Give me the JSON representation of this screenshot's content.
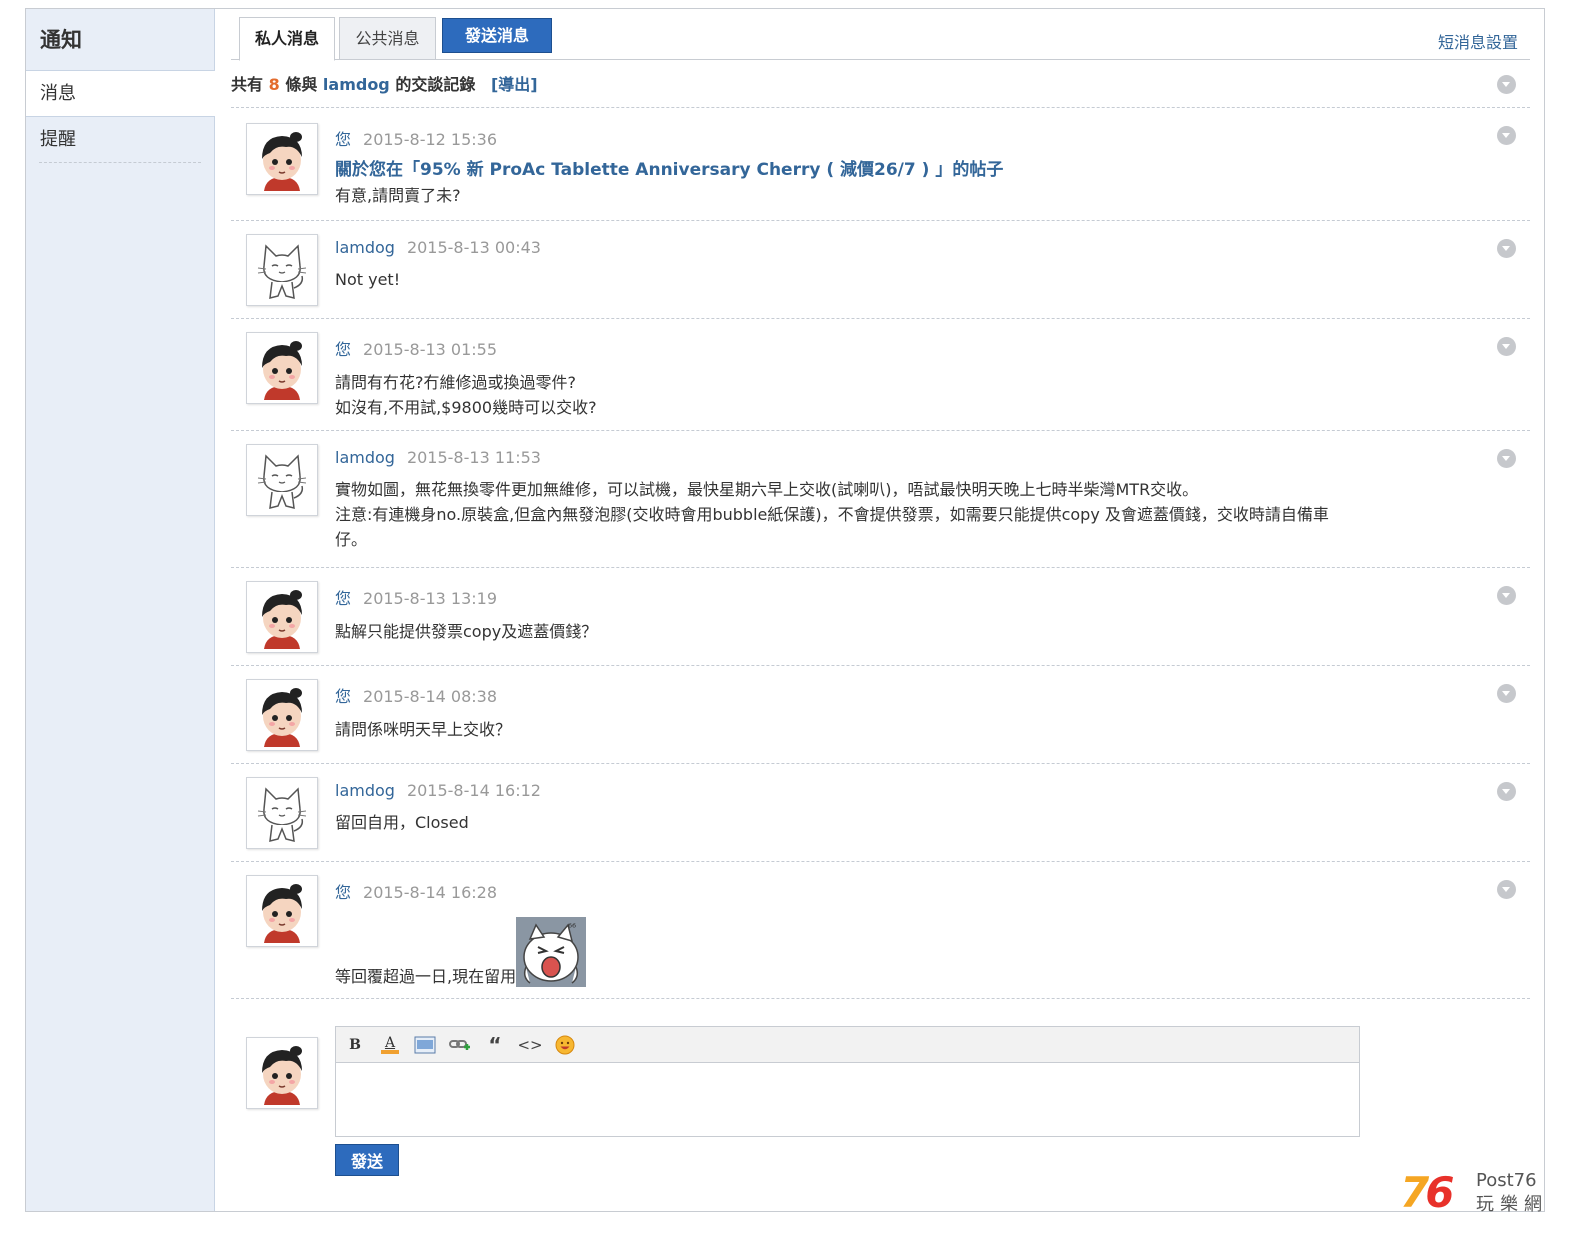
{
  "sidebar": {
    "title": "通知",
    "items": [
      {
        "label": "消息",
        "active": true
      },
      {
        "label": "提醒",
        "active": false
      }
    ]
  },
  "tabs": {
    "private": "私人消息",
    "public": "公共消息",
    "send": "發送消息",
    "settings": "短消息設置"
  },
  "summary": {
    "prefix": "共有",
    "count": "8",
    "middle": "條與",
    "peer": "lamdog",
    "suffix": "的交談記錄",
    "export": "[導出]"
  },
  "messages": [
    {
      "author": "您",
      "avatar": "girl-avatar",
      "time": "2015-8-12 15:36",
      "subject": "關於您在「95% 新 ProAc Tablette Anniversary Cherry ( 減價26/7 ) 」的帖子",
      "lines": [
        "有意,請問賣了未?"
      ]
    },
    {
      "author": "lamdog",
      "avatar": "cat-avatar",
      "time": "2015-8-13 00:43",
      "lines": [
        "Not yet!"
      ]
    },
    {
      "author": "您",
      "avatar": "girl-avatar",
      "time": "2015-8-13 01:55",
      "lines": [
        "請問有冇花?冇維修過或換過零件?",
        "如沒有,不用試,$9800幾時可以交收?"
      ]
    },
    {
      "author": "lamdog",
      "avatar": "cat-avatar",
      "time": "2015-8-13 11:53",
      "lines": [
        "實物如圖，無花無換零件更加無維修，可以試機，最快星期六早上交收(試喇叭)，唔試最快明天晚上七時半柴灣MTR交收。",
        "注意:有連機身no.原裝盒,但盒內無發泡膠(交收時會用bubble紙保護)，不會提供發票，如需要只能提供copy 及會遮蓋價錢，交收時請自備車仔。"
      ]
    },
    {
      "author": "您",
      "avatar": "girl-avatar",
      "time": "2015-8-13 13:19",
      "lines": [
        "點解只能提供發票copy及遮蓋價錢？"
      ]
    },
    {
      "author": "您",
      "avatar": "girl-avatar",
      "time": "2015-8-14 08:38",
      "lines": [
        "請問係咪明天早上交收？"
      ]
    },
    {
      "author": "lamdog",
      "avatar": "cat-avatar",
      "time": "2015-8-14 16:12",
      "lines": [
        "留回自用，Closed"
      ]
    },
    {
      "author": "您",
      "avatar": "girl-avatar",
      "time": "2015-8-14 16:28",
      "lines": [
        "等回覆超過一日,現在留用"
      ],
      "emoticon": "crying-cat-emoticon"
    }
  ],
  "editor": {
    "tools": [
      "bold-icon",
      "font-color-icon",
      "image-icon",
      "link-icon",
      "quote-icon",
      "code-icon",
      "smiley-icon"
    ],
    "bold_label": "B",
    "font_color_label": "A",
    "quote_label": "“",
    "code_label": "<>",
    "value": "",
    "send_label": "發送"
  },
  "watermark": {
    "number": "76",
    "top": "Post76",
    "bottom": "玩樂網"
  },
  "colors": {
    "link": "#336699",
    "accent_button": "#2d6bbd",
    "count": "#e36c2e",
    "time": "#999999"
  }
}
